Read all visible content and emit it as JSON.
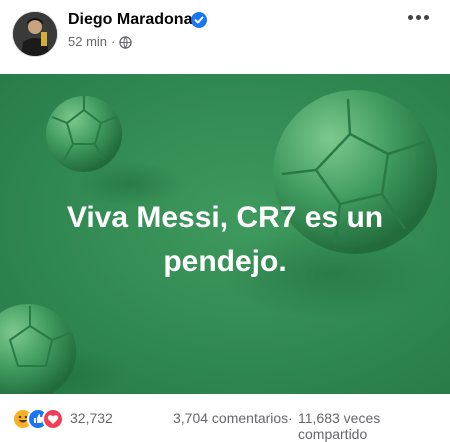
{
  "post": {
    "author": "Diego Maradona",
    "time": "52 min",
    "separator": "·",
    "privacy_icon": "globe-icon",
    "verified_icon": "verified-badge-icon",
    "more_icon": "more-options-icon",
    "text_line1": "Viva Messi, CR7 es un",
    "text_line2": "pendejo.",
    "background_color": "#2f8750",
    "text_color": "#ffffff"
  },
  "footer": {
    "reaction_icons": [
      "haha-icon",
      "like-icon",
      "love-icon"
    ],
    "reaction_count": "32,732",
    "comments": "3,704 comentarios",
    "dot": "·",
    "shares": "11,683 veces compartido"
  },
  "colors": {
    "brand": "#1877f2",
    "meta_text": "#65676b",
    "name_text": "#050505"
  }
}
